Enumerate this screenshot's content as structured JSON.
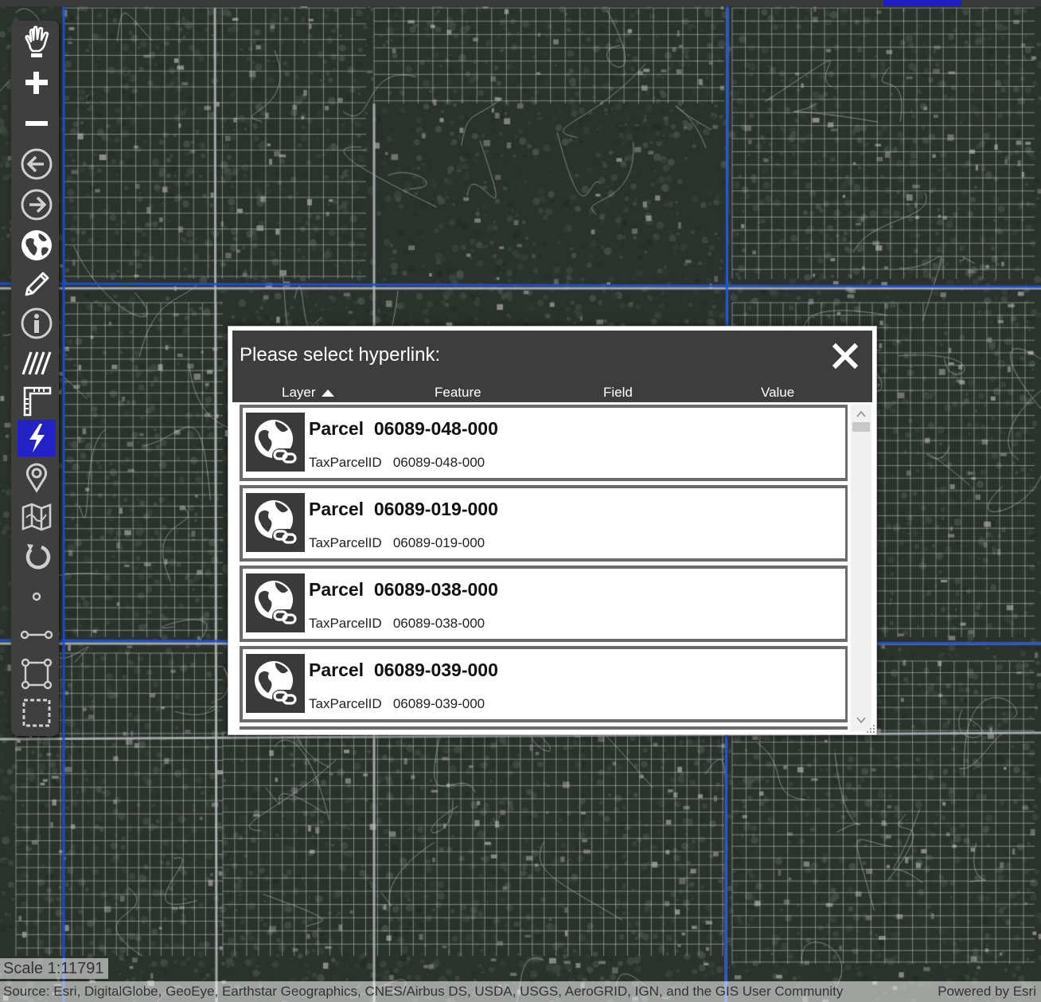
{
  "map": {
    "scale_text": "Scale 1:11791",
    "attribution": "Source: Esri, DigitalGlobe, GeoEye, Earthstar Geographics, CNES/Airbus DS, USDA, USGS, AeroGRID, IGN, and the GIS User Community",
    "powered_by": "Powered by Esri",
    "colors": {
      "imagery": "#2b322c",
      "parcel_lines": "#c8ccd0",
      "section_lines": "#1e50d8"
    }
  },
  "toolbar": {
    "tools": [
      {
        "name": "pan-tool",
        "icon": "hand-icon",
        "active": false
      },
      {
        "name": "zoom-in-tool",
        "icon": "plus-icon",
        "active": false
      },
      {
        "name": "zoom-out-tool",
        "icon": "minus-icon",
        "active": false
      },
      {
        "name": "back-extent-tool",
        "icon": "arrow-left-circle-icon",
        "active": false
      },
      {
        "name": "forward-extent-tool",
        "icon": "arrow-right-circle-icon",
        "active": false
      },
      {
        "name": "full-extent-tool",
        "icon": "globe-icon",
        "active": false
      },
      {
        "name": "draw-tool",
        "icon": "pencil-icon",
        "active": false
      },
      {
        "name": "identify-tool",
        "icon": "info-icon",
        "active": false
      },
      {
        "name": "measure-tool",
        "icon": "measure-lines-icon",
        "active": false
      },
      {
        "name": "ruler-tool",
        "icon": "ruler-icon",
        "active": false
      },
      {
        "name": "hyperlink-tool",
        "icon": "lightning-icon",
        "active": true
      },
      {
        "name": "locate-tool",
        "icon": "location-pin-icon",
        "active": false
      },
      {
        "name": "map-tool",
        "icon": "folded-map-icon",
        "active": false
      },
      {
        "name": "refresh-tool",
        "icon": "refresh-icon",
        "active": false
      },
      {
        "name": "select-point-tool",
        "icon": "point-icon",
        "active": false
      },
      {
        "name": "select-line-tool",
        "icon": "line-icon",
        "active": false
      },
      {
        "name": "select-polygon-tool",
        "icon": "polygon-icon",
        "active": false
      },
      {
        "name": "select-rectangle-tool",
        "icon": "dashed-rectangle-icon",
        "active": false
      }
    ],
    "active_color": "#2323c4"
  },
  "dialog": {
    "title": "Please select hyperlink:",
    "columns": {
      "layer": "Layer",
      "feature": "Feature",
      "field": "Field",
      "value": "Value"
    },
    "sort": {
      "column": "Layer",
      "direction": "ascending"
    },
    "items": [
      {
        "layer": "Parcel",
        "feature": "06089-048-000",
        "field": "TaxParcelID",
        "value": "06089-048-000"
      },
      {
        "layer": "Parcel",
        "feature": "06089-019-000",
        "field": "TaxParcelID",
        "value": "06089-019-000"
      },
      {
        "layer": "Parcel",
        "feature": "06089-038-000",
        "field": "TaxParcelID",
        "value": "06089-038-000"
      },
      {
        "layer": "Parcel",
        "feature": "06089-039-000",
        "field": "TaxParcelID",
        "value": "06089-039-000"
      }
    ]
  }
}
